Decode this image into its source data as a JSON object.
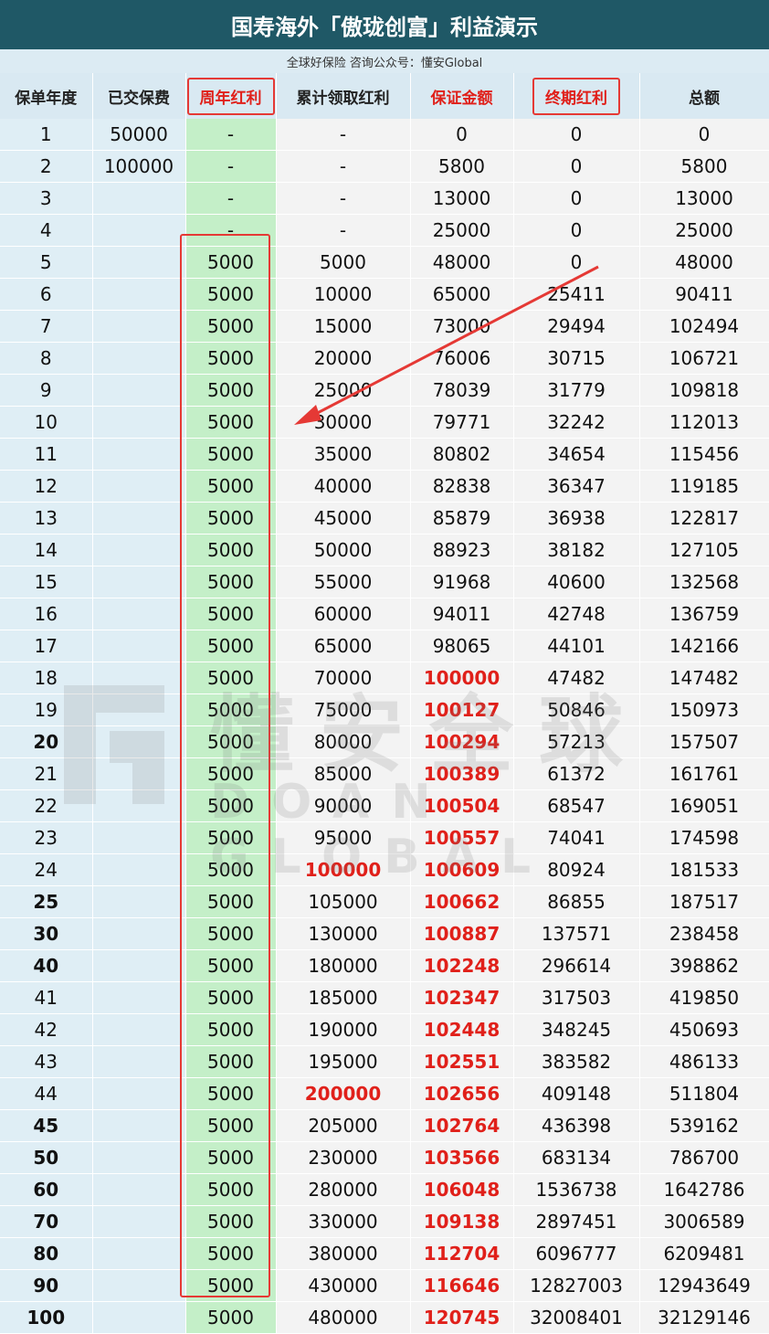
{
  "header": {
    "title": "国寿海外「傲珑创富」利益演示",
    "subtitle": "全球好保险 咨询公众号：懂安Global"
  },
  "columns": [
    "保单年度",
    "已交保费",
    "周年红利",
    "累计领取红利",
    "保证金额",
    "终期红利",
    "总额"
  ],
  "rows": [
    {
      "year": "1",
      "paid": "50000",
      "dividend": "-",
      "cumulative": "-",
      "guaranteed": "0",
      "terminal": "0",
      "total": "0"
    },
    {
      "year": "2",
      "paid": "100000",
      "dividend": "-",
      "cumulative": "-",
      "guaranteed": "5800",
      "terminal": "0",
      "total": "5800"
    },
    {
      "year": "3",
      "paid": "",
      "dividend": "-",
      "cumulative": "-",
      "guaranteed": "13000",
      "terminal": "0",
      "total": "13000"
    },
    {
      "year": "4",
      "paid": "",
      "dividend": "-",
      "cumulative": "-",
      "guaranteed": "25000",
      "terminal": "0",
      "total": "25000"
    },
    {
      "year": "5",
      "paid": "",
      "dividend": "5000",
      "cumulative": "5000",
      "guaranteed": "48000",
      "terminal": "0",
      "total": "48000"
    },
    {
      "year": "6",
      "paid": "",
      "dividend": "5000",
      "cumulative": "10000",
      "guaranteed": "65000",
      "terminal": "25411",
      "total": "90411"
    },
    {
      "year": "7",
      "paid": "",
      "dividend": "5000",
      "cumulative": "15000",
      "guaranteed": "73000",
      "terminal": "29494",
      "total": "102494"
    },
    {
      "year": "8",
      "paid": "",
      "dividend": "5000",
      "cumulative": "20000",
      "guaranteed": "76006",
      "terminal": "30715",
      "total": "106721"
    },
    {
      "year": "9",
      "paid": "",
      "dividend": "5000",
      "cumulative": "25000",
      "guaranteed": "78039",
      "terminal": "31779",
      "total": "109818"
    },
    {
      "year": "10",
      "paid": "",
      "dividend": "5000",
      "cumulative": "30000",
      "guaranteed": "79771",
      "terminal": "32242",
      "total": "112013"
    },
    {
      "year": "11",
      "paid": "",
      "dividend": "5000",
      "cumulative": "35000",
      "guaranteed": "80802",
      "terminal": "34654",
      "total": "115456"
    },
    {
      "year": "12",
      "paid": "",
      "dividend": "5000",
      "cumulative": "40000",
      "guaranteed": "82838",
      "terminal": "36347",
      "total": "119185"
    },
    {
      "year": "13",
      "paid": "",
      "dividend": "5000",
      "cumulative": "45000",
      "guaranteed": "85879",
      "terminal": "36938",
      "total": "122817"
    },
    {
      "year": "14",
      "paid": "",
      "dividend": "5000",
      "cumulative": "50000",
      "guaranteed": "88923",
      "terminal": "38182",
      "total": "127105"
    },
    {
      "year": "15",
      "paid": "",
      "dividend": "5000",
      "cumulative": "55000",
      "guaranteed": "91968",
      "terminal": "40600",
      "total": "132568"
    },
    {
      "year": "16",
      "paid": "",
      "dividend": "5000",
      "cumulative": "60000",
      "guaranteed": "94011",
      "terminal": "42748",
      "total": "136759"
    },
    {
      "year": "17",
      "paid": "",
      "dividend": "5000",
      "cumulative": "65000",
      "guaranteed": "98065",
      "terminal": "44101",
      "total": "142166"
    },
    {
      "year": "18",
      "paid": "",
      "dividend": "5000",
      "cumulative": "70000",
      "guaranteed": "100000",
      "terminal": "47482",
      "total": "147482"
    },
    {
      "year": "19",
      "paid": "",
      "dividend": "5000",
      "cumulative": "75000",
      "guaranteed": "100127",
      "terminal": "50846",
      "total": "150973"
    },
    {
      "year": "20",
      "paid": "",
      "dividend": "5000",
      "cumulative": "80000",
      "guaranteed": "100294",
      "terminal": "57213",
      "total": "157507"
    },
    {
      "year": "21",
      "paid": "",
      "dividend": "5000",
      "cumulative": "85000",
      "guaranteed": "100389",
      "terminal": "61372",
      "total": "161761"
    },
    {
      "year": "22",
      "paid": "",
      "dividend": "5000",
      "cumulative": "90000",
      "guaranteed": "100504",
      "terminal": "68547",
      "total": "169051"
    },
    {
      "year": "23",
      "paid": "",
      "dividend": "5000",
      "cumulative": "95000",
      "guaranteed": "100557",
      "terminal": "74041",
      "total": "174598"
    },
    {
      "year": "24",
      "paid": "",
      "dividend": "5000",
      "cumulative": "100000",
      "guaranteed": "100609",
      "terminal": "80924",
      "total": "181533"
    },
    {
      "year": "25",
      "paid": "",
      "dividend": "5000",
      "cumulative": "105000",
      "guaranteed": "100662",
      "terminal": "86855",
      "total": "187517"
    },
    {
      "year": "30",
      "paid": "",
      "dividend": "5000",
      "cumulative": "130000",
      "guaranteed": "100887",
      "terminal": "137571",
      "total": "238458"
    },
    {
      "year": "40",
      "paid": "",
      "dividend": "5000",
      "cumulative": "180000",
      "guaranteed": "102248",
      "terminal": "296614",
      "total": "398862"
    },
    {
      "year": "41",
      "paid": "",
      "dividend": "5000",
      "cumulative": "185000",
      "guaranteed": "102347",
      "terminal": "317503",
      "total": "419850"
    },
    {
      "year": "42",
      "paid": "",
      "dividend": "5000",
      "cumulative": "190000",
      "guaranteed": "102448",
      "terminal": "348245",
      "total": "450693"
    },
    {
      "year": "43",
      "paid": "",
      "dividend": "5000",
      "cumulative": "195000",
      "guaranteed": "102551",
      "terminal": "383582",
      "total": "486133"
    },
    {
      "year": "44",
      "paid": "",
      "dividend": "5000",
      "cumulative": "200000",
      "guaranteed": "102656",
      "terminal": "409148",
      "total": "511804"
    },
    {
      "year": "45",
      "paid": "",
      "dividend": "5000",
      "cumulative": "205000",
      "guaranteed": "102764",
      "terminal": "436398",
      "total": "539162"
    },
    {
      "year": "50",
      "paid": "",
      "dividend": "5000",
      "cumulative": "230000",
      "guaranteed": "103566",
      "terminal": "683134",
      "total": "786700"
    },
    {
      "year": "60",
      "paid": "",
      "dividend": "5000",
      "cumulative": "280000",
      "guaranteed": "106048",
      "terminal": "1536738",
      "total": "1642786"
    },
    {
      "year": "70",
      "paid": "",
      "dividend": "5000",
      "cumulative": "330000",
      "guaranteed": "109138",
      "terminal": "2897451",
      "total": "3006589"
    },
    {
      "year": "80",
      "paid": "",
      "dividend": "5000",
      "cumulative": "380000",
      "guaranteed": "112704",
      "terminal": "6096777",
      "total": "6209481"
    },
    {
      "year": "90",
      "paid": "",
      "dividend": "5000",
      "cumulative": "430000",
      "guaranteed": "116646",
      "terminal": "12827003",
      "total": "12943649"
    },
    {
      "year": "100",
      "paid": "",
      "dividend": "5000",
      "cumulative": "480000",
      "guaranteed": "120745",
      "terminal": "32008401",
      "total": "32129146"
    }
  ],
  "bold_years": [
    "20",
    "25",
    "30",
    "40",
    "45",
    "50",
    "60",
    "70",
    "80",
    "90",
    "100"
  ],
  "red_cumulative": [
    "100000",
    "200000"
  ],
  "guaranteed_red_from_year": 18,
  "watermark": {
    "text_cn": "懂安全球",
    "text_en": "DOAN GLOBAL"
  },
  "colors": {
    "title_bg": "#1f5866",
    "header_bg": "#d9e9f2",
    "accent_red": "#e0201a",
    "dividend_green": "#c4efc8"
  }
}
